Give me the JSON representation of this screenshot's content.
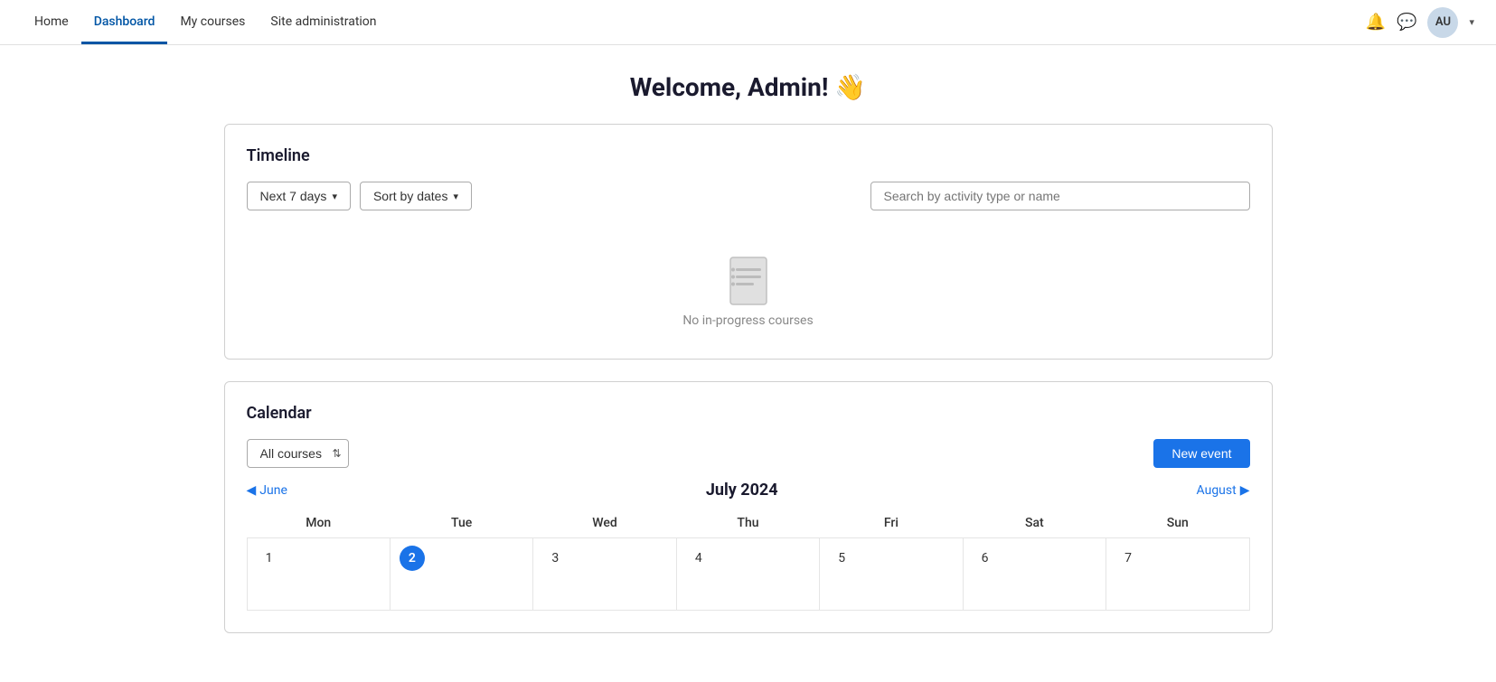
{
  "nav": {
    "links": [
      {
        "label": "Home",
        "active": false
      },
      {
        "label": "Dashboard",
        "active": true
      },
      {
        "label": "My courses",
        "active": false
      },
      {
        "label": "Site administration",
        "active": false
      }
    ],
    "avatar_initials": "AU",
    "avatar_caret": "▾"
  },
  "welcome": {
    "title": "Welcome, Admin! 👋"
  },
  "timeline": {
    "section_title": "Timeline",
    "filter_days_label": "Next 7 days",
    "filter_sort_label": "Sort by dates",
    "search_placeholder": "Search by activity type or name",
    "no_courses_text": "No in-progress courses"
  },
  "calendar": {
    "section_title": "Calendar",
    "filter_courses_label": "All courses",
    "new_event_label": "New event",
    "prev_month_label": "June",
    "next_month_label": "August",
    "current_month": "July 2024",
    "days_of_week": [
      "Mon",
      "Tue",
      "Wed",
      "Thu",
      "Fri",
      "Sat",
      "Sun"
    ],
    "weeks": [
      [
        {
          "day": "1",
          "today": false
        },
        {
          "day": "2",
          "today": true
        },
        {
          "day": "3",
          "today": false
        },
        {
          "day": "4",
          "today": false
        },
        {
          "day": "5",
          "today": false
        },
        {
          "day": "6",
          "today": false
        },
        {
          "day": "7",
          "today": false
        }
      ]
    ]
  }
}
